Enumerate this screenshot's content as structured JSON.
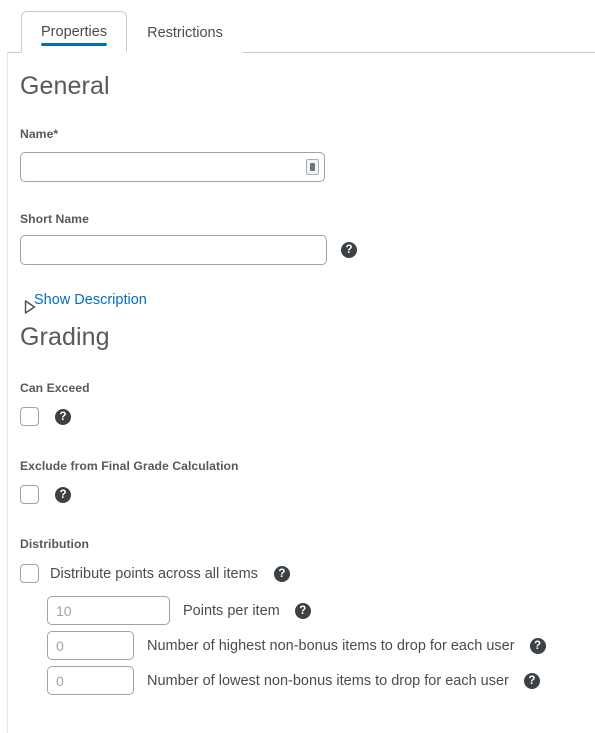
{
  "tabs": [
    {
      "label": "Properties",
      "active": true
    },
    {
      "label": "Restrictions",
      "active": false
    }
  ],
  "sections": {
    "general": {
      "heading": "General",
      "name": {
        "label": "Name",
        "required_marker": "*",
        "value": "",
        "placeholder": "",
        "ime_icon": "input-indicator-icon"
      },
      "short_name": {
        "label": "Short Name",
        "value": "",
        "placeholder": "",
        "help_icon": "help-icon"
      },
      "show_description": {
        "label": "Show Description",
        "expander_icon": "triangle-right-icon",
        "expanded": false
      }
    },
    "grading": {
      "heading": "Grading",
      "can_exceed": {
        "label": "Can Exceed",
        "checked": false,
        "help_icon": "help-icon"
      },
      "exclude_from_final": {
        "label": "Exclude from Final Grade Calculation",
        "checked": false,
        "help_icon": "help-icon"
      },
      "distribution": {
        "label": "Distribution",
        "distribute_points": {
          "label": "Distribute points across all items",
          "checked": false,
          "help_icon": "help-icon"
        },
        "rows": [
          {
            "value": "",
            "placeholder": "10",
            "label": "Points per item",
            "help_icon": "help-icon",
            "input_width": 123
          },
          {
            "value": "",
            "placeholder": "0",
            "label": "Number of highest non-bonus items to drop for each user",
            "help_icon": "help-icon",
            "input_width": 87
          },
          {
            "value": "",
            "placeholder": "0",
            "label": "Number of lowest non-bonus items to drop for each user",
            "help_icon": "help-icon",
            "input_width": 87
          }
        ]
      }
    }
  },
  "colors": {
    "accent": "#006fbf",
    "heading": "#565a5c",
    "text": "#494c4e",
    "border": "#9ea4a8",
    "tab_border": "#c5ccd3",
    "help_bg": "#3c4145"
  },
  "glyphs": {
    "help": "?"
  }
}
